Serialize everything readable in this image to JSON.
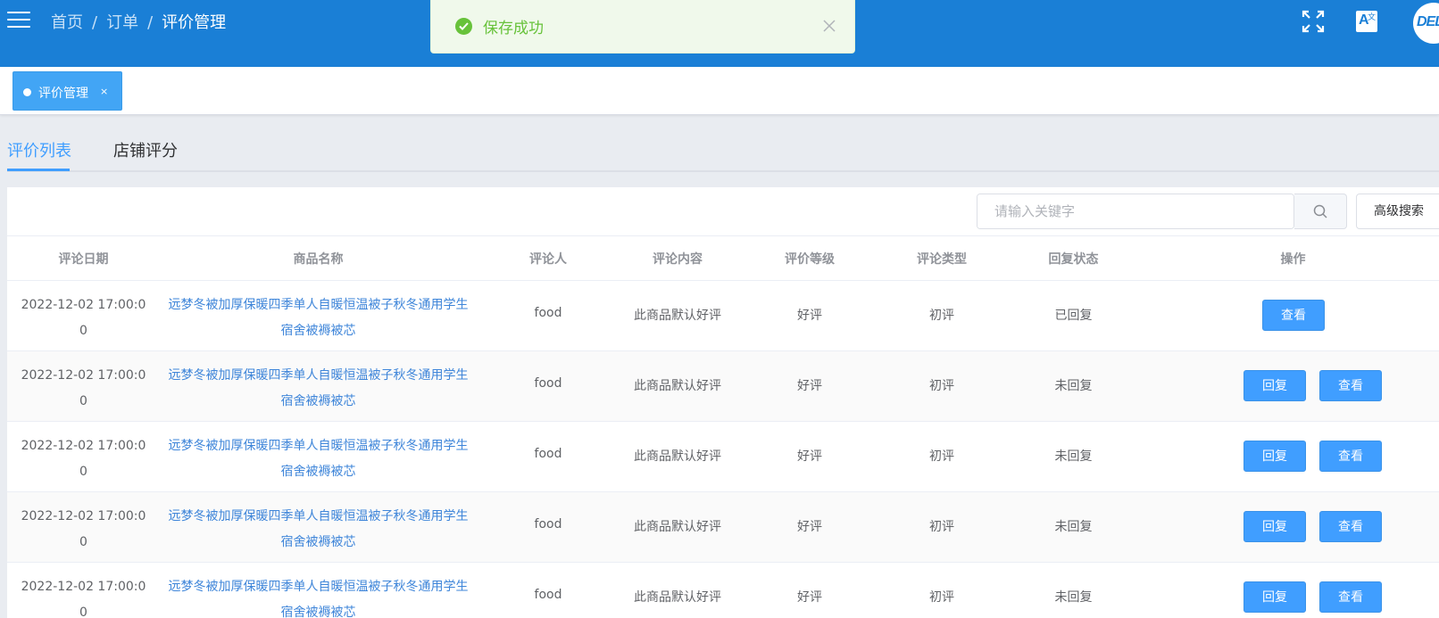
{
  "header": {
    "breadcrumb": [
      "首页",
      "订单",
      "评价管理"
    ],
    "separator": "/",
    "translate_glyph": "A",
    "translate_sup": "文",
    "avatar_text": "DELL",
    "icons": [
      "menu-icon",
      "fullscreen-icon",
      "translate-icon"
    ]
  },
  "toast": {
    "message": "保存成功",
    "type": "success",
    "color": "#67c23a"
  },
  "tags_view": {
    "tags": [
      {
        "label": "评价管理",
        "close": "×",
        "active": true
      }
    ]
  },
  "tabs": [
    {
      "label": "评价列表",
      "active": true
    },
    {
      "label": "店铺评分",
      "active": false
    }
  ],
  "search": {
    "placeholder": "请输入关键字",
    "value": "",
    "advanced_label": "高级搜索"
  },
  "table": {
    "columns": [
      "评论日期",
      "商品名称",
      "评论人",
      "评论内容",
      "评价等级",
      "评论类型",
      "回复状态",
      "操作"
    ],
    "rows": [
      {
        "date": "2022-12-02 17:00:00",
        "product": "远梦冬被加厚保暖四季单人自暖恒温被子秋冬通用学生宿舍被褥被芯",
        "reviewer": "food",
        "content": "此商品默认好评",
        "grade": "好评",
        "type": "初评",
        "reply_status": "已回复",
        "actions": [
          "查看"
        ]
      },
      {
        "date": "2022-12-02 17:00:00",
        "product": "远梦冬被加厚保暖四季单人自暖恒温被子秋冬通用学生宿舍被褥被芯",
        "reviewer": "food",
        "content": "此商品默认好评",
        "grade": "好评",
        "type": "初评",
        "reply_status": "未回复",
        "actions": [
          "回复",
          "查看"
        ]
      },
      {
        "date": "2022-12-02 17:00:00",
        "product": "远梦冬被加厚保暖四季单人自暖恒温被子秋冬通用学生宿舍被褥被芯",
        "reviewer": "food",
        "content": "此商品默认好评",
        "grade": "好评",
        "type": "初评",
        "reply_status": "未回复",
        "actions": [
          "回复",
          "查看"
        ]
      },
      {
        "date": "2022-12-02 17:00:00",
        "product": "远梦冬被加厚保暖四季单人自暖恒温被子秋冬通用学生宿舍被褥被芯",
        "reviewer": "food",
        "content": "此商品默认好评",
        "grade": "好评",
        "type": "初评",
        "reply_status": "未回复",
        "actions": [
          "回复",
          "查看"
        ]
      },
      {
        "date": "2022-12-02 17:00:00",
        "product": "远梦冬被加厚保暖四季单人自暖恒温被子秋冬通用学生宿舍被褥被芯",
        "reviewer": "food",
        "content": "此商品默认好评",
        "grade": "好评",
        "type": "初评",
        "reply_status": "未回复",
        "actions": [
          "回复",
          "查看"
        ]
      }
    ]
  },
  "colors": {
    "header": "#1a7fd6",
    "primary": "#409eff",
    "link": "#3e85d9",
    "success": "#67c23a"
  }
}
